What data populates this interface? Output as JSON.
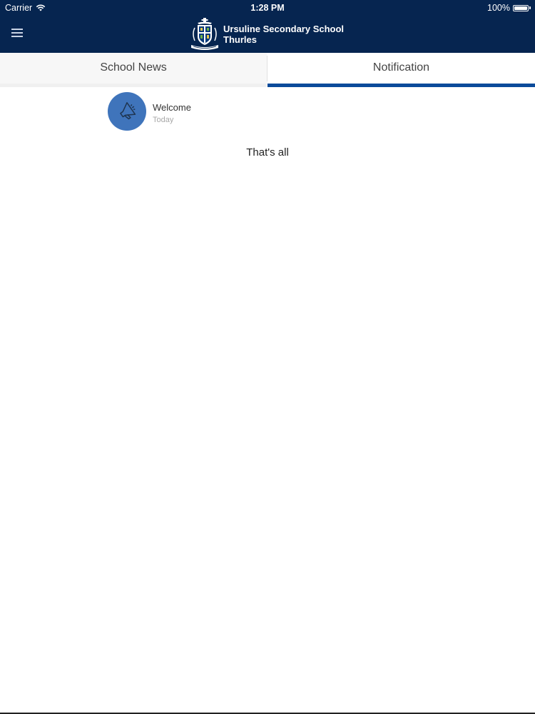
{
  "status_bar": {
    "carrier": "Carrier",
    "time": "1:28 PM",
    "battery": "100%",
    "battery_level": 1.0
  },
  "header": {
    "title_line1": "Ursuline Secondary School",
    "title_line2": "Thurles",
    "menu_icon": "hamburger-menu-icon",
    "logo_icon": "school-crest-icon"
  },
  "tabs": [
    {
      "label": "School News",
      "selected": false
    },
    {
      "label": "Notification",
      "selected": true
    }
  ],
  "notifications": [
    {
      "title": "Welcome",
      "date": "Today",
      "icon": "megaphone-icon"
    }
  ],
  "end_message": "That's all",
  "colors": {
    "header_bg": "#062550",
    "tab_indicator": "#0b4b9a",
    "avatar_bg": "#3f74bb"
  }
}
